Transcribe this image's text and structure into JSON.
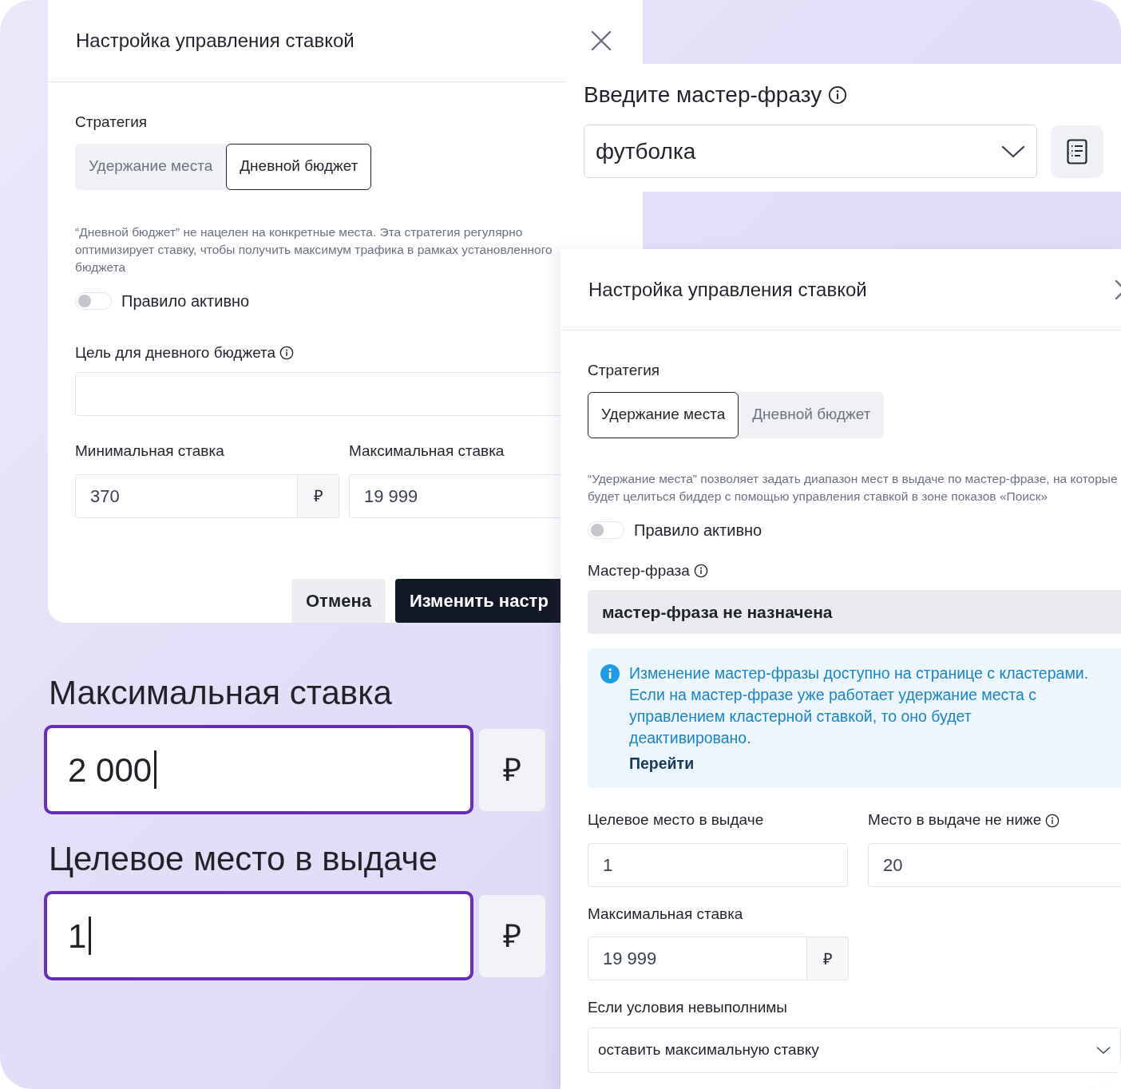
{
  "dialog_daily": {
    "title": "Настройка управления ставкой",
    "strategy_label": "Стратегия",
    "strategies": [
      {
        "label": "Удержание места",
        "selected": false
      },
      {
        "label": "Дневной бюджет",
        "selected": true
      }
    ],
    "description": "“Дневной бюджет” не нацелен на конкретные места. Эта стратегия регулярно оптимизирует ставку, чтобы получить максимум трафика в рамках установленного бюджета",
    "rule_toggle": {
      "label": "Правило активно",
      "on": false
    },
    "goal": {
      "label": "Цель для дневного бюджета"
    },
    "min_rate": {
      "label": "Минимальная ставка",
      "value": "370",
      "currency": "₽"
    },
    "max_rate": {
      "label": "Максимальная ставка",
      "value": "19 999"
    },
    "buttons": [
      {
        "label": "Отмена",
        "kind": "secondary"
      },
      {
        "label": "Изменить настр",
        "kind": "primary"
      }
    ]
  },
  "master_phrase_card": {
    "title": "Введите мастер-фразу",
    "value": "футболка"
  },
  "big_fields": [
    {
      "label": "Максимальная ставка",
      "value": "2 000",
      "currency": "₽"
    },
    {
      "label": "Целевое место в выдаче",
      "value": "1",
      "currency": "₽"
    }
  ],
  "dialog_hold": {
    "title": "Настройка управления ставкой",
    "strategy_label": "Стратегия",
    "strategies": [
      {
        "label": "Удержание места",
        "selected": true
      },
      {
        "label": "Дневной бюджет",
        "selected": false
      }
    ],
    "description": "“Удержание места” позволяет задать диапазон мест в выдаче по мастер-фразе, на которые будет целиться биддер с помощью управления ставкой в зоне показов «Поиск»",
    "rule_toggle": {
      "label": "Правило активно",
      "on": false
    },
    "master_phrase": {
      "label": "Мастер-фраза",
      "value": "мастер-фраза не назначена",
      "disabled": true
    },
    "notice": {
      "text": "Изменение мастер-фразы доступно на странице с кластерами. Если на мастер-фразе уже работает удержание места с управлением кластерной ставкой, то оно будет деактивировано.",
      "link": "Перейти"
    },
    "target": {
      "label": "Целевое место в выдаче",
      "value": "1"
    },
    "not_below": {
      "label": "Место в выдаче не ниже",
      "value": "20"
    },
    "max_rate": {
      "label": "Максимальная ставка",
      "value": "19 999",
      "currency": "₽"
    },
    "fallback": {
      "label": "Если условия невыполнимы",
      "value": "оставить максимальную ставку"
    }
  }
}
